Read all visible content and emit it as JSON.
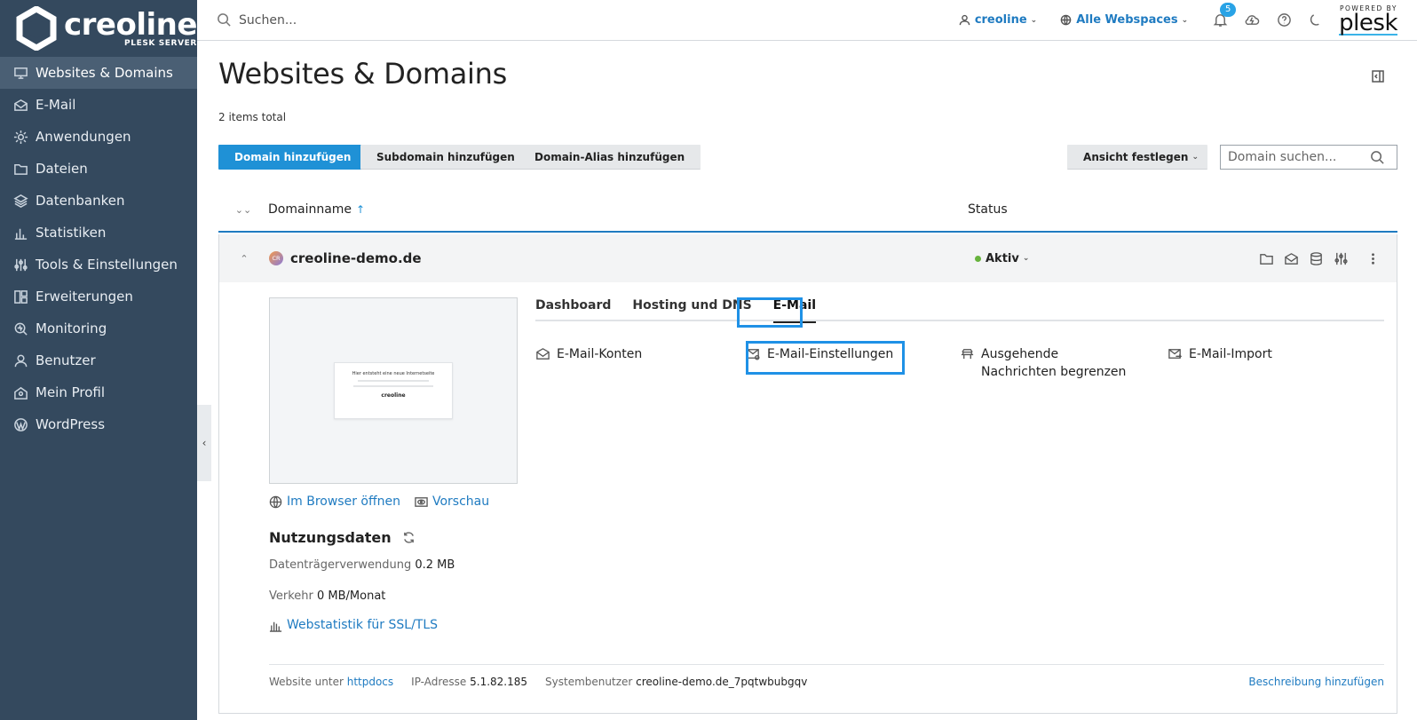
{
  "sidebar": {
    "logo": {
      "brand": "creoline",
      "sub": "PLESK SERVER"
    },
    "items": [
      {
        "label": "Websites & Domains",
        "icon": "monitor-icon",
        "active": true
      },
      {
        "label": "E-Mail",
        "icon": "mail-icon"
      },
      {
        "label": "Anwendungen",
        "icon": "gear-icon"
      },
      {
        "label": "Dateien",
        "icon": "folder-icon"
      },
      {
        "label": "Datenbanken",
        "icon": "layers-icon"
      },
      {
        "label": "Statistiken",
        "icon": "bar-chart-icon"
      },
      {
        "label": "Tools & Einstellungen",
        "icon": "sliders-icon"
      },
      {
        "label": "Erweiterungen",
        "icon": "grid-icon"
      },
      {
        "label": "Monitoring",
        "icon": "monitoring-icon"
      },
      {
        "label": "Benutzer",
        "icon": "user-icon"
      },
      {
        "label": "Mein Profil",
        "icon": "profile-icon"
      },
      {
        "label": "WordPress",
        "icon": "wordpress-icon"
      }
    ]
  },
  "topbar": {
    "search_placeholder": "Suchen...",
    "user": "creoline",
    "webspaces": "Alle Webspaces",
    "notifications_count": "5",
    "plesk_powered": "POWERED BY",
    "plesk_logo": "plesk"
  },
  "page": {
    "title": "Websites & Domains",
    "items_total": "2 items total"
  },
  "toolbar": {
    "add_domain": "Domain hinzufügen",
    "add_subdomain": "Subdomain hinzufügen",
    "add_alias": "Domain-Alias hinzufügen",
    "view": "Ansicht festlegen",
    "domain_search_placeholder": "Domain suchen..."
  },
  "table": {
    "col_name": "Domainname",
    "sort_indicator": "↑",
    "col_status": "Status"
  },
  "domain": {
    "favicon": "CR",
    "name": "creoline-demo.de",
    "status": "Aktiv",
    "preview": {
      "title": "Hier entsteht eine neue Internetseite",
      "logo": "creoline"
    },
    "links": {
      "open_browser": "Im Browser öffnen",
      "preview": "Vorschau"
    },
    "usage": {
      "title": "Nutzungsdaten",
      "disk_label": "Datenträgerverwendung",
      "disk_value": "0.2 MB",
      "traffic_label": "Verkehr",
      "traffic_value": "0 MB/Monat",
      "webstat": "Webstatistik für SSL/TLS"
    },
    "tabs": [
      "Dashboard",
      "Hosting und DNS",
      "E-Mail"
    ],
    "active_tab": "E-Mail",
    "mail_actions": [
      {
        "label": "E-Mail-Konten",
        "icon": "mail-open-icon"
      },
      {
        "label": "E-Mail-Einstellungen",
        "icon": "mail-settings-icon"
      },
      {
        "label": "Ausgehende Nachrichten begrenzen",
        "icon": "limit-icon"
      },
      {
        "label": "E-Mail-Import",
        "icon": "mail-import-icon"
      }
    ],
    "footer": {
      "website_label": "Website unter",
      "website_value": "httpdocs",
      "ip_label": "IP-Adresse",
      "ip_value": "5.1.82.185",
      "sysuser_label": "Systembenutzer",
      "sysuser_value": "creoline-demo.de_7pqtwbubgqv",
      "add_description": "Beschreibung hinzufügen"
    }
  },
  "colors": {
    "sidebar_bg": "#34495e",
    "accent": "#1f91d6",
    "active_green": "#67b33d"
  }
}
